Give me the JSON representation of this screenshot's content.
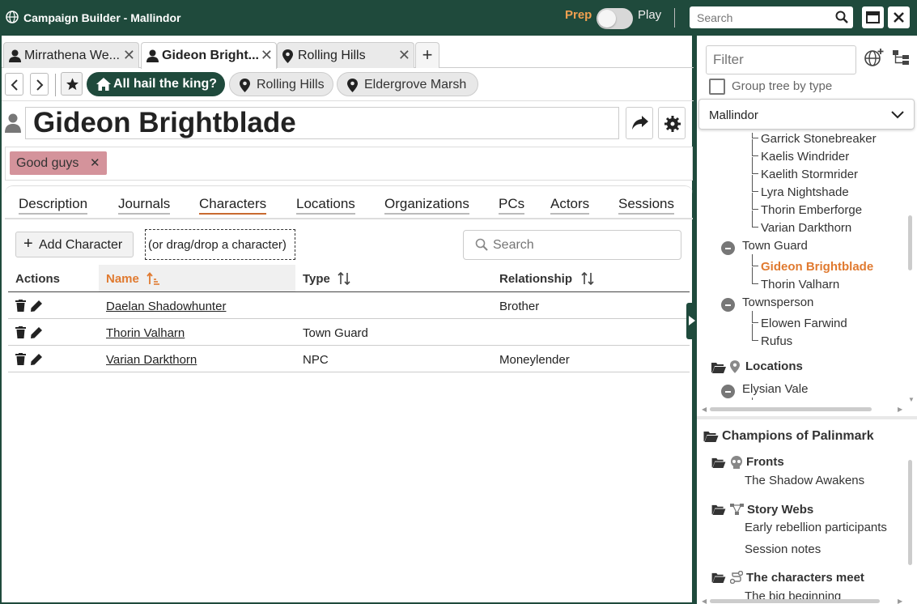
{
  "window": {
    "title": "Campaign Builder - Mallindor",
    "prep_label": "Prep",
    "play_label": "Play",
    "search_placeholder": "Search"
  },
  "tabs": [
    {
      "label": "Mirrathena We...",
      "icon": "person-icon"
    },
    {
      "label": "Gideon Bright...",
      "icon": "person-icon",
      "active": true
    },
    {
      "label": "Rolling Hills",
      "icon": "location-pin-icon"
    }
  ],
  "nav": {
    "pills": [
      {
        "label": "All hail the king?",
        "icon": "home-icon"
      },
      {
        "label": "Rolling Hills",
        "icon": "location-pin-icon"
      },
      {
        "label": "Eldergrove Marsh",
        "icon": "location-pin-icon"
      }
    ]
  },
  "entity": {
    "name": "Gideon Brightblade",
    "tags": [
      {
        "label": "Good guys",
        "color": "#d4939b"
      }
    ]
  },
  "subtabs": [
    "Description",
    "Journals",
    "Characters",
    "Locations",
    "Organizations",
    "PCs",
    "Actors",
    "Sessions"
  ],
  "characters": {
    "add_label": "Add Character",
    "drop_hint": "(or drag/drop a character)",
    "search_placeholder": "Search",
    "columns": {
      "actions": "Actions",
      "name": "Name",
      "type": "Type",
      "relationship": "Relationship"
    },
    "rows": [
      {
        "name": "Daelan Shadowhunter",
        "type": "",
        "relationship": "Brother"
      },
      {
        "name": "Thorin Valharn",
        "type": "Town Guard",
        "relationship": ""
      },
      {
        "name": "Varian Darkthorn",
        "type": "NPC",
        "relationship": "Moneylender"
      }
    ]
  },
  "sidebar": {
    "filter_placeholder": "Filter",
    "group_label": "Group tree by type",
    "setting": "Mallindor",
    "tree": [
      "Garrick Stonebreaker",
      "Kaelis Windrider",
      "Kaelith Stormrider",
      "Lyra Nightshade",
      "Thorin Emberforge",
      "Varian Darkthorn",
      "Town Guard",
      "Gideon Brightblade",
      "Thorin Valharn",
      "Townsperson",
      "Elowen Farwind",
      "Rufus",
      "Locations",
      "Elysian Vale"
    ],
    "campaign": {
      "title": "Champions of Palinmark",
      "fronts_label": "Fronts",
      "front_item": "The Shadow Awakens",
      "webs_label": "Story Webs",
      "web_items": [
        "Early rebellion participants",
        "Session notes"
      ],
      "arc_label": "The characters meet",
      "arc_item": "The big beginning"
    }
  },
  "colors": {
    "brand": "#1f4a3c",
    "accent": "#e07a30",
    "tag": "#d4939b"
  }
}
